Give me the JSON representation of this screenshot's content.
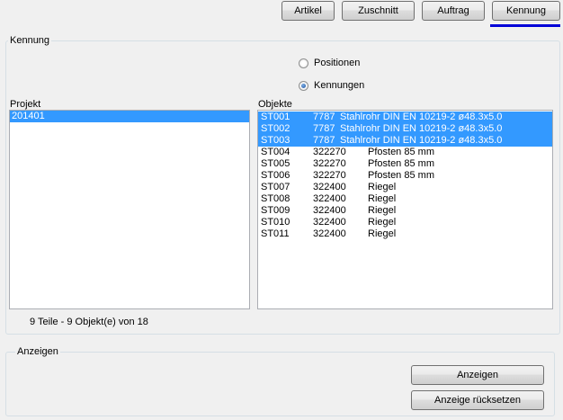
{
  "toolbar": {
    "buttons": [
      {
        "label": "Artikel"
      },
      {
        "label": "Zuschnitt"
      },
      {
        "label": "Auftrag"
      },
      {
        "label": "Kennung"
      }
    ]
  },
  "kennung_group": {
    "label": "Kennung",
    "radios": [
      {
        "label": "Positionen",
        "checked": false
      },
      {
        "label": "Kennungen",
        "checked": true
      }
    ],
    "projekt": {
      "label": "Projekt",
      "items": [
        {
          "text": "201401",
          "selected": true
        }
      ]
    },
    "objekte": {
      "label": "Objekte",
      "rows": [
        {
          "id": "ST001",
          "code": "7787",
          "desc": "Stahlrohr DIN EN 10219-2 ø48.3x5.0",
          "selected": true
        },
        {
          "id": "ST002",
          "code": "7787",
          "desc": "Stahlrohr DIN EN 10219-2 ø48.3x5.0",
          "selected": true
        },
        {
          "id": "ST003",
          "code": "7787",
          "desc": "Stahlrohr DIN EN 10219-2 ø48.3x5.0",
          "selected": true
        },
        {
          "id": "ST004",
          "code": "322270",
          "desc": "Pfosten 85 mm",
          "selected": false
        },
        {
          "id": "ST005",
          "code": "322270",
          "desc": "Pfosten 85 mm",
          "selected": false
        },
        {
          "id": "ST006",
          "code": "322270",
          "desc": "Pfosten 85 mm",
          "selected": false
        },
        {
          "id": "ST007",
          "code": "322400",
          "desc": "Riegel",
          "selected": false
        },
        {
          "id": "ST008",
          "code": "322400",
          "desc": "Riegel",
          "selected": false
        },
        {
          "id": "ST009",
          "code": "322400",
          "desc": "Riegel",
          "selected": false
        },
        {
          "id": "ST010",
          "code": "322400",
          "desc": "Riegel",
          "selected": false
        },
        {
          "id": "ST011",
          "code": "322400",
          "desc": "Riegel",
          "selected": false
        }
      ]
    },
    "status": "9 Teile - 9 Objekt(e) von 18"
  },
  "anzeigen_group": {
    "label": "Anzeigen",
    "show_label": "Anzeigen",
    "reset_label": "Anzeige rücksetzen"
  },
  "colors": {
    "selection": "#3399ff",
    "active_tab_underline": "#0000d8"
  }
}
